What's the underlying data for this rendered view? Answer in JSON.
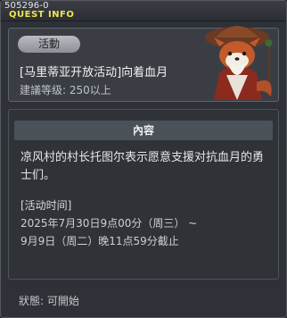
{
  "window": {
    "quest_id": "505296-0",
    "title": "QUEST INFO"
  },
  "event": {
    "badge": "活動",
    "title": "[马里蒂亚开放活动]向着血月",
    "level_requirement": "建議等级: 250以上"
  },
  "content": {
    "header": "內容",
    "description": "凉风村的村长托图尔表示愿意支援对抗血月的勇士们。",
    "period_label": "[活动时间]",
    "period_line1": "2025年7月30日9点00分（周三） ~",
    "period_line2": "9月9日（周二）晚11点59分截止"
  },
  "status": {
    "text": "狀態: 可開始"
  },
  "icons": {
    "npc": "red-panda-npc-icon"
  }
}
